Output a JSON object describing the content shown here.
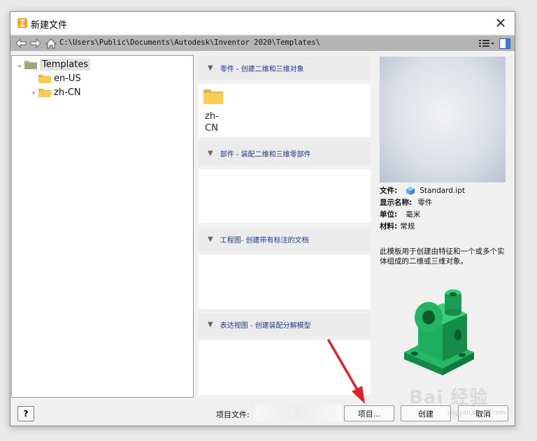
{
  "window": {
    "title": "新建文件",
    "close_glyph": "✕"
  },
  "pathbar": {
    "path": "C:\\Users\\Public\\Documents\\Autodesk\\Inventor 2020\\Templates\\"
  },
  "tree": {
    "items": [
      {
        "label": "Templates",
        "expanded": true,
        "selected": true
      },
      {
        "label": "en-US",
        "expanded": false,
        "selected": false
      },
      {
        "label": "zh-CN",
        "expanded": false,
        "selected": false,
        "has_children": true
      }
    ]
  },
  "categories": [
    {
      "header": "零件 - 创建二维和三维对象",
      "items": [
        {
          "label_line1": "zh-",
          "label_line2": "CN"
        }
      ]
    },
    {
      "header": "部件 - 装配二维和三维零部件",
      "items": []
    },
    {
      "header": "工程图- 创建带有标注的文档",
      "items": []
    },
    {
      "header": "表达视图 - 创建装配分解模型",
      "items": []
    }
  ],
  "info": {
    "file_label": "文件:",
    "file_value": "Standard.ipt",
    "display_name_label": "显示名称:",
    "display_name_value": "零件",
    "unit_label": "单位:",
    "unit_value": "毫米",
    "material_label": "材料:",
    "material_value": "常规",
    "description": "此模板用于创建由特征和一个或多个实体组成的二维或三维对象。"
  },
  "footer": {
    "help_label": "?",
    "project_file_label": "项目文件:",
    "projects_button": "项目...",
    "create_button": "创建",
    "cancel_button": "取消"
  },
  "watermark": {
    "text": "Bai 经验",
    "sub": "jingyan.baidu.com"
  },
  "colors": {
    "accent_text": "#1a3a8f",
    "part_green": "#1aa05a",
    "arrow_red": "#e0202a"
  }
}
